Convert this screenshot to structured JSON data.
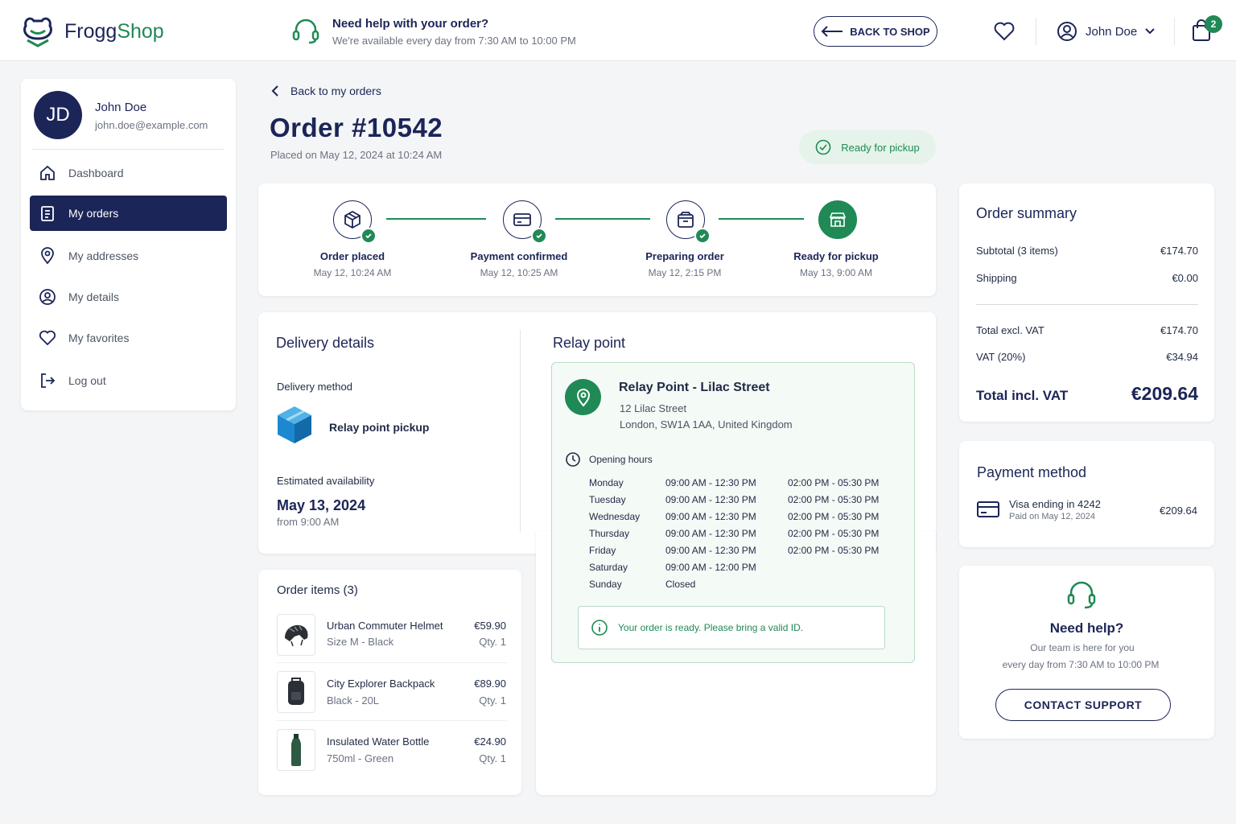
{
  "header": {
    "brand_part1": "Frogg",
    "brand_part2": "Shop",
    "help_title": "Need help with your order?",
    "help_subtitle": "We're available every day from 7:30 AM to 10:00 PM",
    "back_to_shop": "BACK TO SHOP",
    "user_name": "John Doe",
    "cart_count": "2",
    "icons": [
      "frog-logo-icon",
      "headset-icon",
      "arrow-left-icon",
      "heart-icon",
      "user-circle-icon",
      "chevron-down-icon",
      "shopping-bag-icon"
    ]
  },
  "sidebar": {
    "initials": "JD",
    "name": "John Doe",
    "email": "john.doe@example.com",
    "items": [
      {
        "label": "Dashboard",
        "icon": "home-icon"
      },
      {
        "label": "My orders",
        "icon": "clipboard-icon",
        "active": true
      },
      {
        "label": "My addresses",
        "icon": "map-pin-icon"
      },
      {
        "label": "My details",
        "icon": "user-circle-icon"
      },
      {
        "label": "My favorites",
        "icon": "heart-icon"
      },
      {
        "label": "Log out",
        "icon": "logout-icon"
      }
    ]
  },
  "order": {
    "back_link": "Back to my orders",
    "title": "Order #10542",
    "placed": "Placed on May 12, 2024 at 10:24 AM",
    "status": "Ready for pickup"
  },
  "steps": [
    {
      "label": "Order placed",
      "date": "May 12, 10:24 AM",
      "icon": "package-icon"
    },
    {
      "label": "Payment confirmed",
      "date": "May 12, 10:25 AM",
      "icon": "card-icon"
    },
    {
      "label": "Preparing order",
      "date": "May 12, 2:15 PM",
      "icon": "box-icon"
    },
    {
      "label": "Ready for pickup",
      "date": "May 13, 9:00 AM",
      "icon": "store-icon"
    }
  ],
  "delivery": {
    "title": "Delivery details",
    "method_label": "Delivery method",
    "method": "Relay point pickup",
    "availability_label": "Estimated availability",
    "availability_date": "May 13, 2024",
    "availability_time": "from 9:00 AM"
  },
  "relay": {
    "title": "Relay point",
    "name": "Relay Point - Lilac Street",
    "street": "12 Lilac Street",
    "city": "London, SW1A 1AA, United Kingdom",
    "hours_label": "Opening hours",
    "hours": [
      {
        "day": "Monday",
        "am": "09:00 AM - 12:30 PM",
        "pm": "02:00 PM - 05:30 PM"
      },
      {
        "day": "Tuesday",
        "am": "09:00 AM - 12:30 PM",
        "pm": "02:00 PM - 05:30 PM"
      },
      {
        "day": "Wednesday",
        "am": "09:00 AM - 12:30 PM",
        "pm": "02:00 PM - 05:30 PM"
      },
      {
        "day": "Thursday",
        "am": "09:00 AM - 12:30 PM",
        "pm": "02:00 PM - 05:30 PM"
      },
      {
        "day": "Friday",
        "am": "09:00 AM - 12:30 PM",
        "pm": "02:00 PM - 05:30 PM"
      },
      {
        "day": "Saturday",
        "am": "09:00 AM - 12:00 PM",
        "pm": ""
      },
      {
        "day": "Sunday",
        "am": "Closed",
        "pm": ""
      }
    ],
    "note": "Your order is ready. Please bring a valid ID."
  },
  "items": {
    "title": "Order items (3)",
    "list": [
      {
        "name": "Urban Commuter Helmet",
        "variant": "Size M - Black",
        "price": "€59.90",
        "qty": "Qty. 1",
        "icon": "helmet-icon"
      },
      {
        "name": "City Explorer Backpack",
        "variant": "Black - 20L",
        "price": "€89.90",
        "qty": "Qty. 1",
        "icon": "backpack-icon"
      },
      {
        "name": "Insulated Water Bottle",
        "variant": "750ml - Green",
        "price": "€24.90",
        "qty": "Qty. 1",
        "icon": "bottle-icon"
      }
    ]
  },
  "summary": {
    "title": "Order summary",
    "subtotal_label": "Subtotal (3 items)",
    "subtotal": "€174.70",
    "shipping_label": "Shipping",
    "shipping": "€0.00",
    "excl_label": "Total excl. VAT",
    "excl": "€174.70",
    "vat_label": "VAT (20%)",
    "vat": "€34.94",
    "total_label": "Total incl. VAT",
    "total": "€209.64"
  },
  "payment": {
    "title": "Payment method",
    "card": "Visa ending in 4242",
    "paid": "Paid on May 12, 2024",
    "amount": "€209.64"
  },
  "support": {
    "title": "Need help?",
    "line1": "Our team is here for you",
    "line2": "every day from 7:30 AM to 10:00 PM",
    "button": "CONTACT SUPPORT"
  },
  "colors": {
    "navy": "#1c2558",
    "green": "#1f8a55",
    "light_green": "#e5f3ea"
  }
}
